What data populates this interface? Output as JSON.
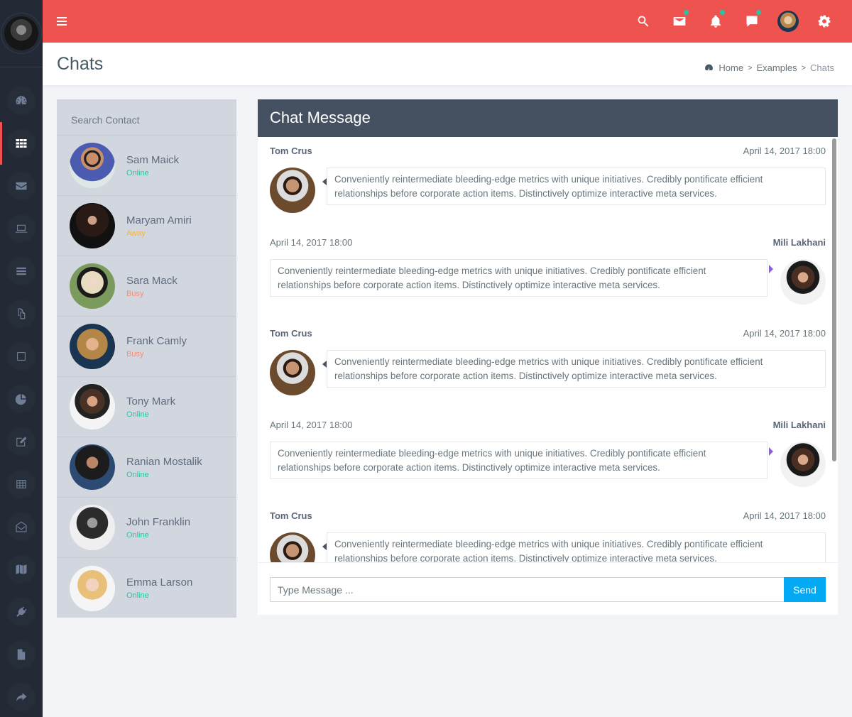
{
  "app": {
    "accent_color": "#ef5350",
    "sidebar_color": "#232a35"
  },
  "sidebar": {
    "items": [
      {
        "icon": "dashboard-gauge-icon",
        "active": false
      },
      {
        "icon": "apps-grid-icon",
        "active": true
      },
      {
        "icon": "envelope-icon",
        "active": false
      },
      {
        "icon": "laptop-icon",
        "active": false
      },
      {
        "icon": "list-bars-icon",
        "active": false
      },
      {
        "icon": "copy-files-icon",
        "active": false
      },
      {
        "icon": "square-icon",
        "active": false
      },
      {
        "icon": "pie-chart-icon",
        "active": false
      },
      {
        "icon": "edit-icon",
        "active": false
      },
      {
        "icon": "table-icon",
        "active": false
      },
      {
        "icon": "envelope-open-icon",
        "active": false
      },
      {
        "icon": "map-icon",
        "active": false
      },
      {
        "icon": "plug-icon",
        "active": false
      },
      {
        "icon": "file-icon",
        "active": false
      },
      {
        "icon": "share-icon",
        "active": false
      }
    ]
  },
  "topbar": {
    "icons": [
      "search-icon",
      "mail-icon",
      "bell-icon",
      "comment-icon",
      "user-avatar",
      "gear-icon"
    ],
    "notification_dot_color": "#26c6a0"
  },
  "header": {
    "title": "Chats",
    "breadcrumb": {
      "home": "Home",
      "examples": "Examples",
      "current": "Chats",
      "separator": ">"
    }
  },
  "contacts": {
    "search_label": "Search Contact",
    "list": [
      {
        "name": "Sam Maick",
        "status": "Online",
        "status_color": "#26c6a0",
        "avatar": "av-sam"
      },
      {
        "name": "Maryam Amiri",
        "status": "Away",
        "status_color": "#ffb22b",
        "avatar": "av-maryam"
      },
      {
        "name": "Sara Mack",
        "status": "Busy",
        "status_color": "#fc8a75",
        "avatar": "av-sara"
      },
      {
        "name": "Frank Camly",
        "status": "Busy",
        "status_color": "#fc8a75",
        "avatar": "av-frank"
      },
      {
        "name": "Tony Mark",
        "status": "Online",
        "status_color": "#26c6a0",
        "avatar": "av-tony"
      },
      {
        "name": "Ranian Mostalik",
        "status": "Online",
        "status_color": "#26c6a0",
        "avatar": "av-ranian"
      },
      {
        "name": "John Franklin",
        "status": "Online",
        "status_color": "#26c6a0",
        "avatar": "av-john"
      },
      {
        "name": "Emma Larson",
        "status": "Online",
        "status_color": "#26c6a0",
        "avatar": "av-emma"
      }
    ]
  },
  "chat": {
    "title": "Chat Message",
    "messages": [
      {
        "side": "left",
        "sender": "Tom Crus",
        "time": "April 14, 2017 18:00",
        "text": "Conveniently reintermediate bleeding-edge metrics with unique initiatives. Credibly pontificate efficient relationships before corporate action items. Distinctively optimize interactive meta services."
      },
      {
        "side": "right",
        "sender": "Mili Lakhani",
        "time": "April 14, 2017 18:00",
        "text": "Conveniently reintermediate bleeding-edge metrics with unique initiatives. Credibly pontificate efficient relationships before corporate action items. Distinctively optimize interactive meta services."
      },
      {
        "side": "left",
        "sender": "Tom Crus",
        "time": "April 14, 2017 18:00",
        "text": "Conveniently reintermediate bleeding-edge metrics with unique initiatives. Credibly pontificate efficient relationships before corporate action items. Distinctively optimize interactive meta services."
      },
      {
        "side": "right",
        "sender": "Mili Lakhani",
        "time": "April 14, 2017 18:00",
        "text": "Conveniently reintermediate bleeding-edge metrics with unique initiatives. Credibly pontificate efficient relationships before corporate action items. Distinctively optimize interactive meta services."
      },
      {
        "side": "left",
        "sender": "Tom Crus",
        "time": "April 14, 2017 18:00",
        "text": "Conveniently reintermediate bleeding-edge metrics with unique initiatives. Credibly pontificate efficient relationships before corporate action items. Distinctively optimize interactive meta services."
      }
    ],
    "input_placeholder": "Type Message ...",
    "input_value": "",
    "send_label": "Send",
    "send_color": "#03a9f3"
  }
}
